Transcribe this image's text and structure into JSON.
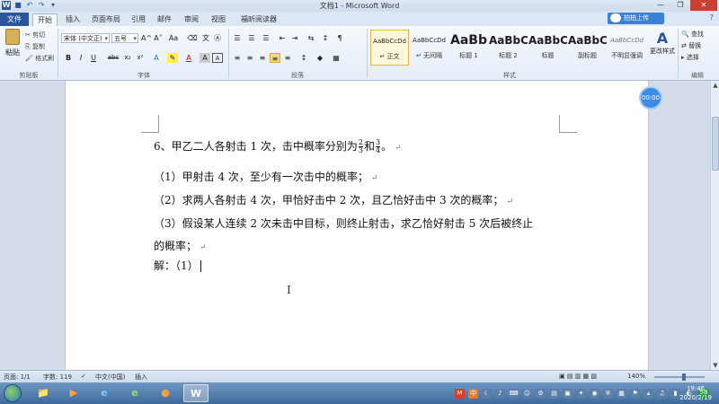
{
  "window": {
    "title": "文档1 - Microsoft Word",
    "qat_icons": [
      "word-icon",
      "save-icon",
      "undo-icon",
      "redo-icon",
      "customize-icon"
    ]
  },
  "tabs": [
    {
      "label": "文件"
    },
    {
      "label": "开始"
    },
    {
      "label": "插入"
    },
    {
      "label": "页面布局"
    },
    {
      "label": "引用"
    },
    {
      "label": "邮件"
    },
    {
      "label": "审阅"
    },
    {
      "label": "视图"
    },
    {
      "label": "福昕阅读器"
    }
  ],
  "upload_button": "拍拍上传",
  "ribbon": {
    "clipboard": {
      "paste": "粘贴",
      "cut": "剪切",
      "copy": "复制",
      "format_painter": "格式刷",
      "label": "剪贴板"
    },
    "font": {
      "font_name": "宋体 (中文正)",
      "font_size": "五号",
      "label": "字体",
      "bold": "B",
      "italic": "I",
      "underline": "U",
      "strike": "abc",
      "sub": "x₂",
      "sup": "x²",
      "grow": "A^",
      "shrink": "A˅",
      "case": "Aa",
      "wen": "文",
      "style_a": "A"
    },
    "paragraph": {
      "label": "段落"
    },
    "styles": {
      "label": "样式",
      "items": [
        {
          "preview": "AaBbCcDd",
          "name": "↵ 正文"
        },
        {
          "preview": "AaBbCcDd",
          "name": "↵ 无间隔"
        },
        {
          "preview": "AaBb",
          "name": "标题 1"
        },
        {
          "preview": "AaBbC",
          "name": "标题 2"
        },
        {
          "preview": "AaBbC",
          "name": "标题"
        },
        {
          "preview": "AaBbC",
          "name": "副标题"
        },
        {
          "preview": "AaBbCcDd",
          "name": "不明显强调"
        }
      ],
      "change_styles": "更改样式"
    },
    "editing": {
      "find": "查找",
      "replace": "替换",
      "select": "选择",
      "label": "编辑"
    }
  },
  "document": {
    "q_prefix": "6、甲乙二人各射击 1 次，击中概率分别为",
    "frac1": {
      "num": "2",
      "den": "3"
    },
    "and": "和",
    "frac2": {
      "num": "3",
      "den": "4"
    },
    "q_end": "。",
    "lines": [
      "（1）甲射击 4 次，至少有一次击中的概率；",
      "（2）求两人各射击 4 次，甲恰好击中 2 次，且乙恰好击中 3 次的概率；",
      "（3）假设某人连续 2 次未击中目标，则终止射击，求乙恰好射击 5 次后被终止",
      "的概率；"
    ],
    "answer": "解：（1）",
    "para_mark": "↵"
  },
  "timer": "00:00",
  "statusbar": {
    "page": "页面: 1/1",
    "words": "字数: 119",
    "language": "中文(中国)",
    "mode": "插入",
    "zoom": "140%",
    "zoom_fraction": 0.6
  },
  "taskbar": {
    "apps": [
      {
        "icon": "explorer-icon"
      },
      {
        "icon": "media-player-icon"
      },
      {
        "icon": "ie-icon"
      },
      {
        "icon": "browser-360-icon"
      },
      {
        "icon": "firefox-icon"
      },
      {
        "icon": "word-taskbar-icon"
      }
    ],
    "battery_badge": "58",
    "time": "19:46",
    "date": "2020/2/19"
  },
  "colors": {
    "accent": "#2b579a",
    "file_tab": "#2b579a",
    "upload": "#3c82d4",
    "timer": "#3d8de6"
  }
}
